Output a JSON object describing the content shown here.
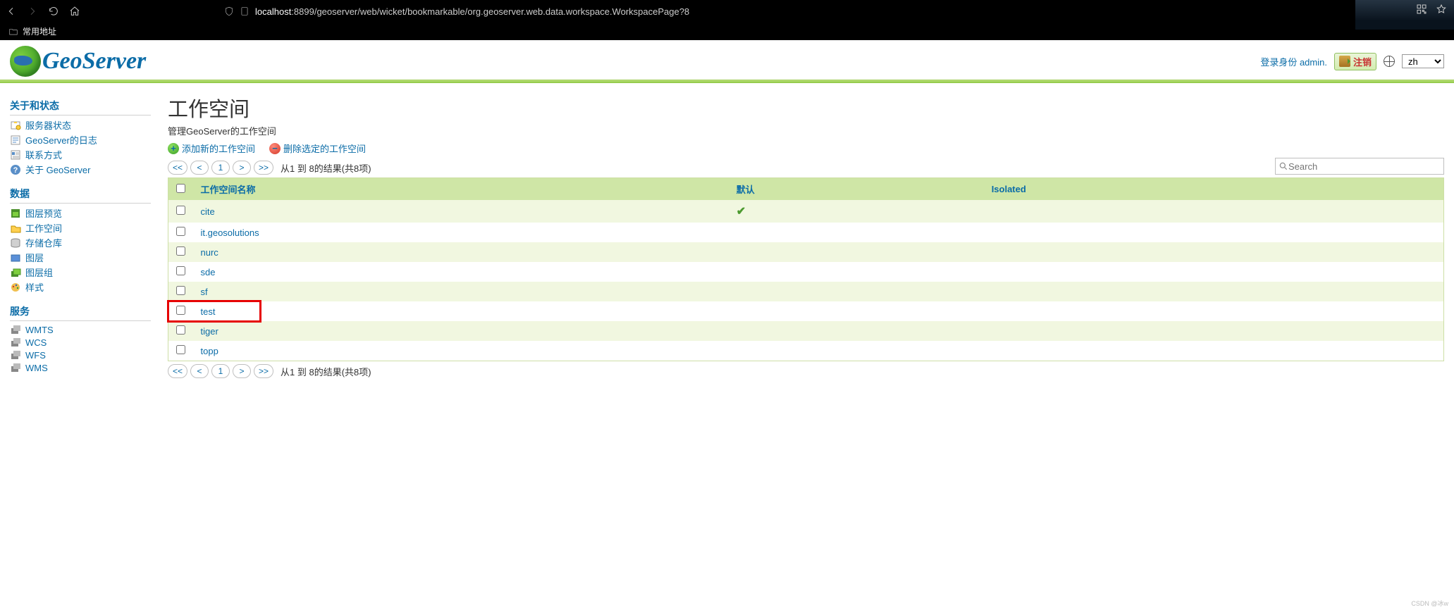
{
  "browser": {
    "bookmark_label": "常用地址",
    "url_prefix": "localhost",
    "url_rest": ":8899/geoserver/web/wicket/bookmarkable/org.geoserver.web.data.workspace.WorkspacePage?8"
  },
  "header": {
    "logo_text": "GeoServer",
    "login_as": "登录身份",
    "username": "admin.",
    "logout": "注销",
    "lang_value": "zh"
  },
  "sidebar": {
    "groups": [
      {
        "title": "关于和状态",
        "items": [
          {
            "icon": "server-status-icon",
            "label": "服务器状态"
          },
          {
            "icon": "log-icon",
            "label": "GeoServer的日志"
          },
          {
            "icon": "contact-icon",
            "label": "联系方式"
          },
          {
            "icon": "about-icon",
            "label": "关于 GeoServer"
          }
        ]
      },
      {
        "title": "数据",
        "items": [
          {
            "icon": "layer-preview-icon",
            "label": "图层预览"
          },
          {
            "icon": "workspace-icon",
            "label": "工作空间"
          },
          {
            "icon": "store-icon",
            "label": "存储仓库"
          },
          {
            "icon": "layer-icon",
            "label": "图层"
          },
          {
            "icon": "layergroup-icon",
            "label": "图层组"
          },
          {
            "icon": "style-icon",
            "label": "样式"
          }
        ]
      },
      {
        "title": "服务",
        "items": [
          {
            "icon": "wmts-icon",
            "label": "WMTS"
          },
          {
            "icon": "wcs-icon",
            "label": "WCS"
          },
          {
            "icon": "wfs-icon",
            "label": "WFS"
          },
          {
            "icon": "wms-icon",
            "label": "WMS"
          }
        ]
      }
    ]
  },
  "page": {
    "title": "工作空间",
    "subtitle": "管理GeoServer的工作空间",
    "add_label": "添加新的工作空间",
    "delete_label": "删除选定的工作空间",
    "pager": {
      "first": "<<",
      "prev": "<",
      "page": "1",
      "next": ">",
      "last": ">>",
      "info": "从1 到 8的结果(共8项)"
    },
    "search_placeholder": "Search",
    "columns": {
      "name": "工作空间名称",
      "default": "默认",
      "isolated": "Isolated"
    },
    "rows": [
      {
        "name": "cite",
        "default": true,
        "isolated": false,
        "highlight": false
      },
      {
        "name": "it.geosolutions",
        "default": false,
        "isolated": false,
        "highlight": false
      },
      {
        "name": "nurc",
        "default": false,
        "isolated": false,
        "highlight": false
      },
      {
        "name": "sde",
        "default": false,
        "isolated": false,
        "highlight": false
      },
      {
        "name": "sf",
        "default": false,
        "isolated": false,
        "highlight": false
      },
      {
        "name": "test",
        "default": false,
        "isolated": false,
        "highlight": true
      },
      {
        "name": "tiger",
        "default": false,
        "isolated": false,
        "highlight": false
      },
      {
        "name": "topp",
        "default": false,
        "isolated": false,
        "highlight": false
      }
    ]
  },
  "watermark": "CSDN @冰w"
}
